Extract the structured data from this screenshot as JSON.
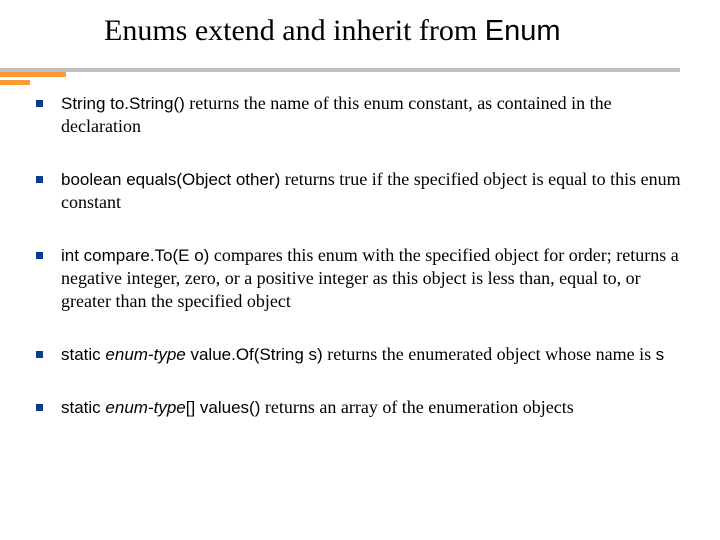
{
  "title": {
    "prefix": "Enums extend and inherit from ",
    "mono": "Enum"
  },
  "bullets": [
    {
      "code1": "String to.String()",
      "text1": " returns the name of this enum constant, as contained in the declaration"
    },
    {
      "code1": "boolean equals(Object other)",
      "text1": " returns true if the specified object is equal to this enum constant"
    },
    {
      "code1": " int compare.To(E o)",
      "text1": " compares this enum with the specified object for order; returns a negative integer, zero, or a positive integer as this object is less than, equal to, or greater than the specified object"
    },
    {
      "code1": "static ",
      "codeItalic": "enum-type",
      "code2": " value.Of(String s)",
      "text1": " returns the enumerated object whose name is ",
      "code3": "s"
    },
    {
      "code1": "static ",
      "codeItalic": "enum-type",
      "code2": "[] values()",
      "text1": " returns an array of the enumeration objects"
    }
  ]
}
